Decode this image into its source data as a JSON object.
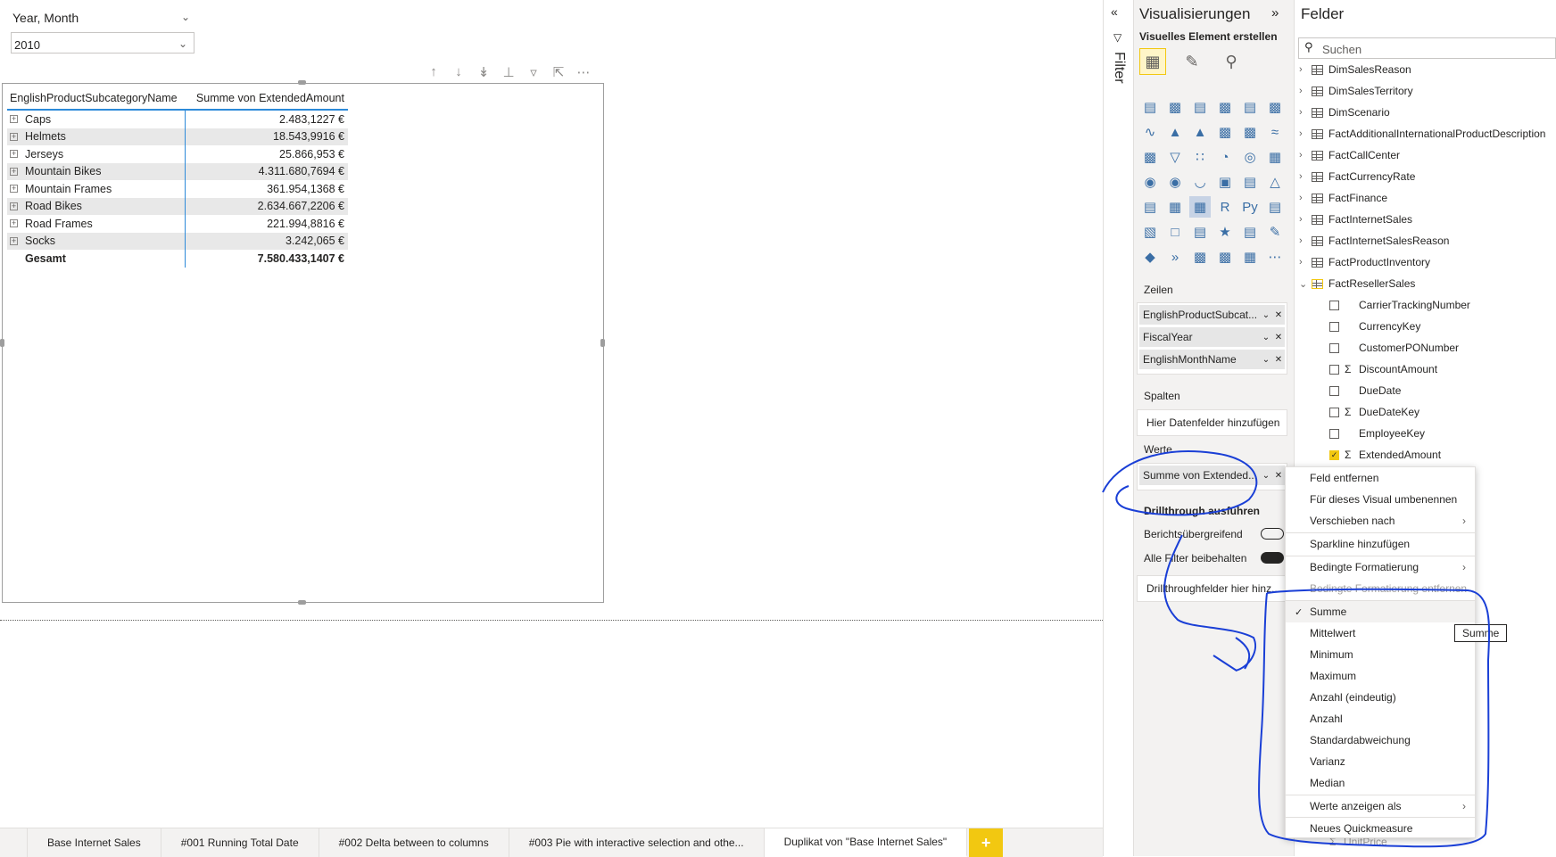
{
  "slicer": {
    "title": "Year, Month",
    "value": "2010"
  },
  "table": {
    "headers": [
      "EnglishProductSubcategoryName",
      "Summe von ExtendedAmount"
    ],
    "rows": [
      {
        "name": "Caps",
        "value": "2.483,1227 €"
      },
      {
        "name": "Helmets",
        "value": "18.543,9916 €"
      },
      {
        "name": "Jerseys",
        "value": "25.866,953 €"
      },
      {
        "name": "Mountain Bikes",
        "value": "4.311.680,7694 €"
      },
      {
        "name": "Mountain Frames",
        "value": "361.954,1368 €"
      },
      {
        "name": "Road Bikes",
        "value": "2.634.667,2206 €"
      },
      {
        "name": "Road Frames",
        "value": "221.994,8816 €"
      },
      {
        "name": "Socks",
        "value": "3.242,065 €"
      }
    ],
    "total": {
      "name": "Gesamt",
      "value": "7.580.433,1407 €"
    }
  },
  "tabs": [
    "Base Internet Sales",
    "#001 Running Total Date",
    "#002 Delta between to columns",
    "#003 Pie with interactive selection and othe...",
    "Duplikat von \"Base Internet Sales\""
  ],
  "tab_add": "+",
  "filter": {
    "label": "Filter"
  },
  "viz": {
    "title": "Visualisierungen",
    "subtitle": "Visuelles Element erstellen",
    "wells": {
      "rows_label": "Zeilen",
      "rows": [
        "EnglishProductSubcat...",
        "FiscalYear",
        "EnglishMonthName"
      ],
      "columns_label": "Spalten",
      "columns_placeholder": "Hier Datenfelder hinzufügen",
      "values_label": "Werte",
      "values": [
        "Summe von Extended..."
      ]
    },
    "drillthrough": {
      "title": "Drillthrough ausführen",
      "cross_report": "Berichtsübergreifend",
      "keep_filters": "Alle Filter beibehalten",
      "placeholder": "Drillthroughfelder hier hinz..."
    }
  },
  "fields": {
    "title": "Felder",
    "search_placeholder": "Suchen",
    "tables": [
      "DimSalesReason",
      "DimSalesTerritory",
      "DimScenario",
      "FactAdditionalInternationalProductDescription",
      "FactCallCenter",
      "FactCurrencyRate",
      "FactFinance",
      "FactInternetSales",
      "FactInternetSalesReason",
      "FactProductInventory",
      "FactResellerSales"
    ],
    "reseller_fields": [
      {
        "name": "CarrierTrackingNumber",
        "sigma": false,
        "checked": false
      },
      {
        "name": "CurrencyKey",
        "sigma": false,
        "checked": false
      },
      {
        "name": "CustomerPONumber",
        "sigma": false,
        "checked": false
      },
      {
        "name": "DiscountAmount",
        "sigma": true,
        "checked": false
      },
      {
        "name": "DueDate",
        "sigma": false,
        "checked": false
      },
      {
        "name": "DueDateKey",
        "sigma": true,
        "checked": false
      },
      {
        "name": "EmployeeKey",
        "sigma": false,
        "checked": false
      },
      {
        "name": "ExtendedAmount",
        "sigma": true,
        "checked": true
      }
    ],
    "last_partial": "UnitPrice"
  },
  "context_menu": {
    "remove": "Feld entfernen",
    "rename": "Für dieses Visual umbenennen",
    "move": "Verschieben nach",
    "sparkline": "Sparkline hinzufügen",
    "cond_format": "Bedingte Formatierung",
    "cond_format_remove": "Bedingte Formatierung entfernen",
    "agg": [
      "Summe",
      "Mittelwert",
      "Minimum",
      "Maximum",
      "Anzahl (eindeutig)",
      "Anzahl",
      "Standardabweichung",
      "Varianz",
      "Median"
    ],
    "show_as": "Werte anzeigen als",
    "quick_measure": "Neues Quickmeasure"
  },
  "tooltip": "Summe",
  "colors": {
    "accent": "#F2C811",
    "table_line": "#2C8AD9",
    "annotation": "#1A3FD6"
  }
}
